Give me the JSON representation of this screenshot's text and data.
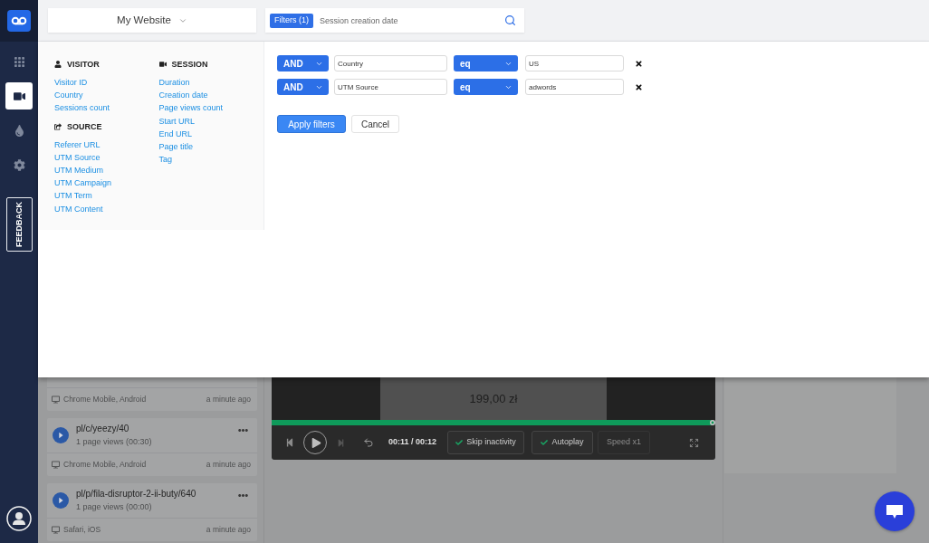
{
  "sidebar": {
    "items": [
      {
        "kind": "grid",
        "selected": false
      },
      {
        "kind": "video",
        "selected": true
      },
      {
        "kind": "drop",
        "selected": false
      },
      {
        "kind": "gear",
        "selected": false
      }
    ],
    "feedback": "FEEDBACK"
  },
  "header": {
    "website_selector": "My Website",
    "search": {
      "filter_chip": "Filters (1)",
      "value": "Session creation date"
    }
  },
  "filter_panel": {
    "columns": [
      {
        "groups": [
          {
            "kind": "person",
            "title": "VISITOR",
            "items": [
              "Visitor ID",
              "Country",
              "Sessions count"
            ]
          },
          {
            "kind": "share",
            "title": "SOURCE",
            "items": [
              "Referer URL",
              "UTM Source",
              "UTM Medium",
              "UTM Campaign",
              "UTM Term",
              "UTM Content"
            ]
          }
        ]
      },
      {
        "groups": [
          {
            "kind": "video",
            "title": "SESSION",
            "items": [
              "Duration",
              "Creation date",
              "Page views count",
              "Start URL",
              "End URL",
              "Page title",
              "Tag"
            ]
          }
        ]
      }
    ],
    "rows": [
      {
        "conjunction": "AND",
        "field": "Country",
        "operator": "eq",
        "value": "US"
      },
      {
        "conjunction": "AND",
        "field": "UTM Source",
        "operator": "eq",
        "value": "adwords"
      }
    ],
    "buttons": [
      {
        "kind": "primary",
        "label": "Apply filters"
      },
      {
        "kind": "secondary",
        "label": "Cancel"
      }
    ]
  },
  "sessions": [
    {
      "device": "Chrome Mobile, Android",
      "time": "a minute ago"
    },
    {
      "url": "pl/c/yeezy/40",
      "views": "1 page views (00:30)",
      "device": "Chrome Mobile, Android",
      "time": "a minute ago"
    },
    {
      "url": "pl/p/fila-disruptor-2-ii-buty/640",
      "views": "1 page views (00:00)",
      "device": "Safari, iOS",
      "time": "a minute ago"
    }
  ],
  "player": {
    "replay_text": "199,00 zł",
    "level": 0.996,
    "time": "00:11 / 00:12",
    "toggles": [
      {
        "label": "Skip inactivity",
        "checked": true
      },
      {
        "label": "Autoplay",
        "checked": true
      }
    ],
    "speed": {
      "label": "Speed x1",
      "disabled": true
    }
  }
}
